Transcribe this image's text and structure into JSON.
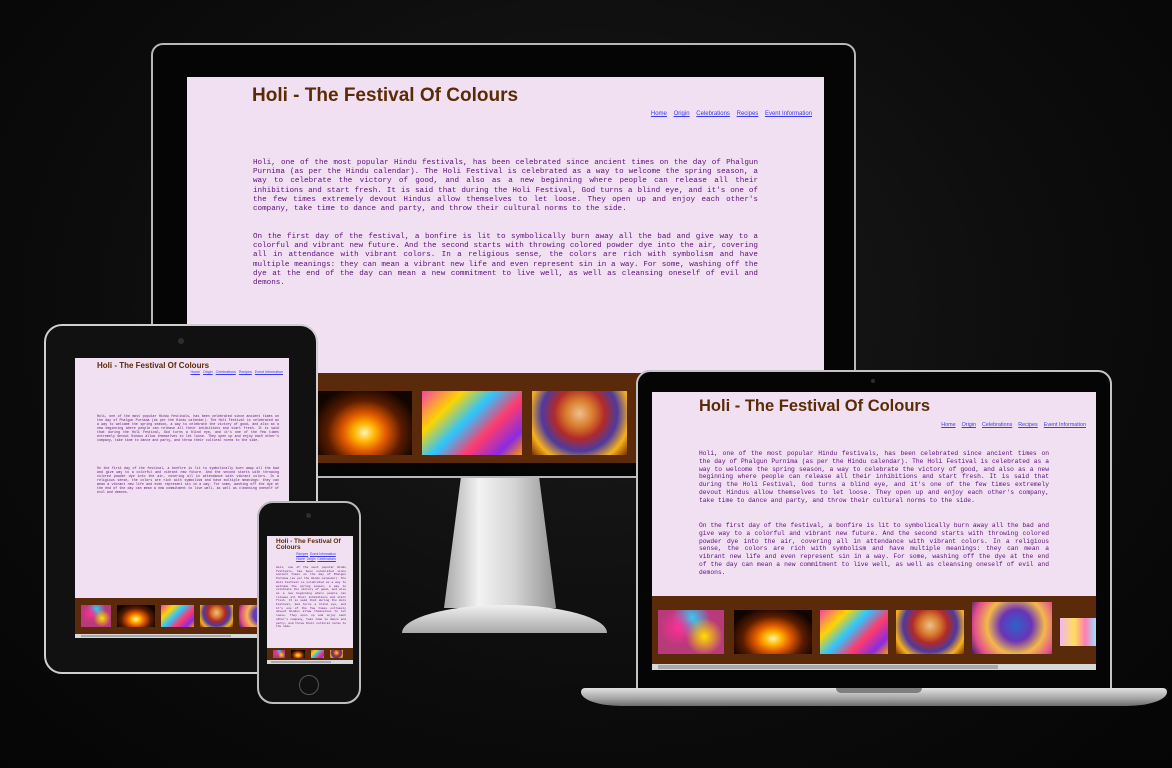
{
  "site": {
    "title": "Holi - The Festival Of Colours",
    "nav": [
      "Home",
      "Origin",
      "Celebrations",
      "Recipes",
      "Event Information"
    ],
    "paragraph1": "Holi, one of the most popular Hindu festivals, has been celebrated since ancient times on the day of Phalgun Purnima (as per the Hindu calendar). The Holi Festival is celebrated as a way to welcome the spring season, a way to celebrate the victory of good, and also as a new beginning where people can release all their inhibitions and start fresh. It is said that during the Holi Festival, God turns a blind eye, and it's one of the few times extremely devout Hindus allow themselves to let loose. They open up and enjoy each other's company, take time to dance and party, and throw their cultural norms to the side.",
    "paragraph2": "On the first day of the festival, a bonfire is lit to symbolically burn away all the bad and give way to a colorful and vibrant new future. And the second starts with throwing colored powder dye into the air, covering all in attendance with vibrant colors. In a religious sense, the colors are rich with symbolism and have multiple meanings: they can mean a vibrant new life and even represent sin in a way. For some, washing off the dye at the end of the day can mean a new commitment to live well, as well as cleansing oneself of evil and demons."
  },
  "colors": {
    "page_background": "#f1e0f1",
    "title": "#5a2c06",
    "body_text": "#5c0f7a",
    "nav_link": "#3a3aee",
    "gallery_background": "#5b2a0a"
  },
  "gallery_icons": [
    "bonfire-photo",
    "colors-photo",
    "painted-man-photo",
    "krishna-photo",
    "colored-faces-photo"
  ]
}
